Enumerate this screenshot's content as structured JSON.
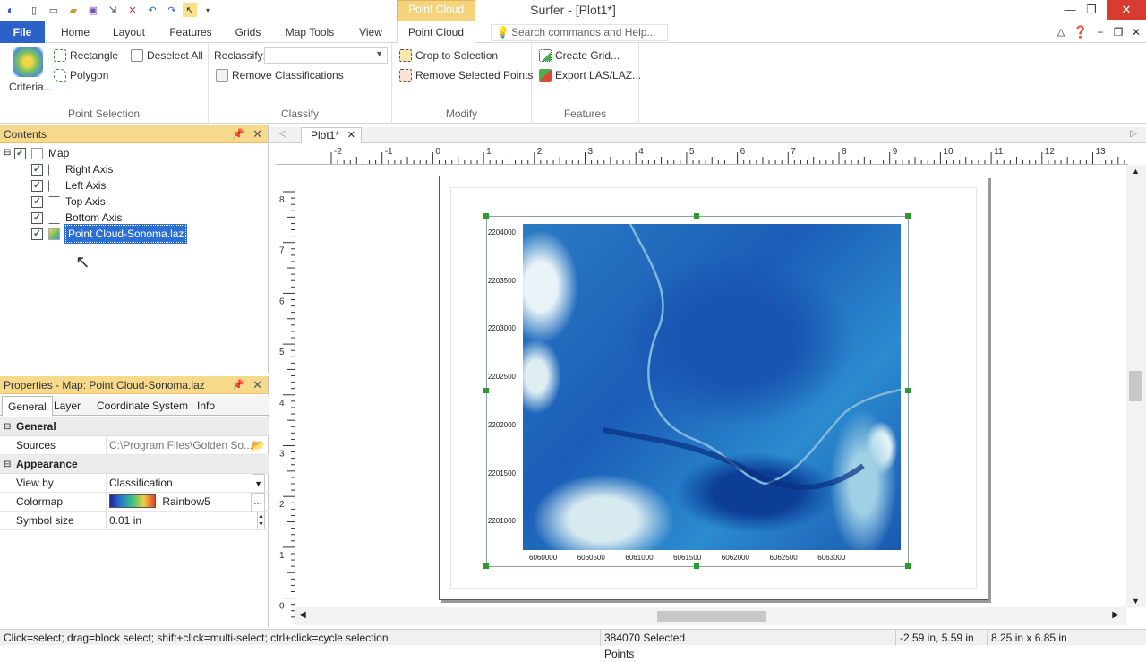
{
  "window": {
    "title": "Surfer - [Plot1*]",
    "context_tab_group": "Point Cloud"
  },
  "tabs": {
    "file": "File",
    "items": [
      "Home",
      "Layout",
      "Features",
      "Grids",
      "Map Tools",
      "View",
      "Point Cloud"
    ],
    "active": "Point Cloud"
  },
  "search": {
    "placeholder": "Search commands and Help..."
  },
  "ribbon": {
    "point_selection": {
      "label": "Point Selection",
      "criteria": "Criteria...",
      "rectangle": "Rectangle",
      "polygon": "Polygon",
      "deselect_all": "Deselect All"
    },
    "classify": {
      "label": "Classify",
      "reclassify": "Reclassify:",
      "reclassify_value": "",
      "remove_classifications": "Remove Classifications"
    },
    "modify": {
      "label": "Modify",
      "crop": "Crop to Selection",
      "remove_selected": "Remove Selected Points"
    },
    "features": {
      "label": "Features",
      "create_grid": "Create Grid...",
      "export": "Export LAS/LAZ..."
    }
  },
  "contents": {
    "title": "Contents",
    "root": "Map",
    "items": [
      "Right Axis",
      "Left Axis",
      "Top Axis",
      "Bottom Axis",
      "Point Cloud-Sonoma.laz"
    ]
  },
  "properties": {
    "title": "Properties - Map: Point Cloud-Sonoma.laz",
    "tabs": [
      "General",
      "Layer",
      "Coordinate System",
      "Info"
    ],
    "active_tab": "General",
    "general_section": "General",
    "sources_label": "Sources",
    "sources_value": "C:\\Program Files\\Golden So...",
    "appearance_section": "Appearance",
    "view_by_label": "View by",
    "view_by_value": "Classification",
    "colormap_label": "Colormap",
    "colormap_value": "Rainbow5",
    "symbol_size_label": "Symbol size",
    "symbol_size_value": "0.01 in"
  },
  "document": {
    "tab": "Plot1*",
    "hruler_labels": [
      "-2",
      "-1",
      "0",
      "1",
      "2",
      "3",
      "4",
      "5",
      "6",
      "7",
      "8",
      "9",
      "10",
      "11",
      "12",
      "13"
    ],
    "vruler_labels": [
      "8",
      "7",
      "6",
      "5",
      "4",
      "3",
      "2",
      "1",
      "0"
    ],
    "y_axis_labels": [
      "2204000",
      "2203500",
      "2203000",
      "2202500",
      "2202000",
      "2201500",
      "2201000"
    ],
    "x_axis_labels": [
      "6060000",
      "6060500",
      "6061000",
      "6061500",
      "6062000",
      "6062500",
      "6063000"
    ]
  },
  "status": {
    "hint": "Click=select; drag=block select; shift+click=multi-select; ctrl+click=cycle selection",
    "selected_points": "384070 Selected Points",
    "coords": "-2.59 in, 5.59 in",
    "size": "8.25 in x 6.85 in"
  },
  "colors": {
    "accent": "#2a62c7",
    "panel_header": "#f7d98c",
    "context_tab": "#f5d37d",
    "selection": "#2d6fd1"
  }
}
